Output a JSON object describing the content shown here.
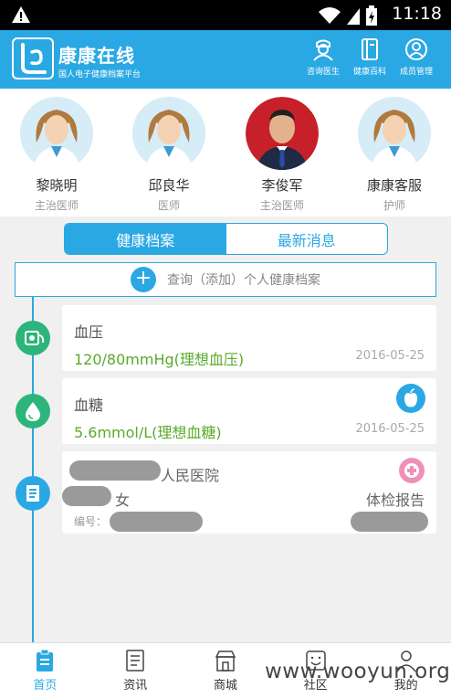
{
  "status_bar": {
    "time": "11:18"
  },
  "header": {
    "brand": "康康在线",
    "subtitle": "国人电子健康档案平台",
    "nav": [
      {
        "label": "咨询医生",
        "icon": "doctor-icon"
      },
      {
        "label": "健康百科",
        "icon": "book-icon"
      },
      {
        "label": "成员管理",
        "icon": "user-icon"
      }
    ]
  },
  "doctors": [
    {
      "name": "黎晓明",
      "title": "主治医师",
      "avatar": "female-doctor-avatar"
    },
    {
      "name": "邱良华",
      "title": "医师",
      "avatar": "female-doctor-avatar"
    },
    {
      "name": "李俊军",
      "title": "主治医师",
      "avatar": "male-doctor-photo"
    },
    {
      "name": "康康客服",
      "title": "护师",
      "avatar": "female-doctor-avatar"
    }
  ],
  "tabs": [
    {
      "label": "健康档案",
      "active": true
    },
    {
      "label": "最新消息",
      "active": false
    }
  ],
  "search": {
    "label": "查询（添加）个人健康档案"
  },
  "records": [
    {
      "title": "血压",
      "value": "120/80mmHg(理想血压)",
      "date": "2016-05-25",
      "icon": "blood-pressure-icon"
    },
    {
      "title": "血糖",
      "value": "5.6mmol/L(理想血糖)",
      "date": "2016-05-25",
      "icon": "blood-drop-icon"
    }
  ],
  "report": {
    "hospital_suffix": "人民医院",
    "gender": "女",
    "type": "体检报告",
    "number_label": "编号："
  },
  "bottom_nav": [
    {
      "label": "首页",
      "active": true
    },
    {
      "label": "资讯",
      "active": false
    },
    {
      "label": "商城",
      "active": false
    },
    {
      "label": "社区",
      "active": false
    },
    {
      "label": "我的",
      "active": false
    }
  ],
  "watermark": "www.wooyun.org",
  "colors": {
    "accent": "#2aa8e3",
    "green": "#5aaa2a",
    "card_icon_green": "#2bb57a"
  }
}
